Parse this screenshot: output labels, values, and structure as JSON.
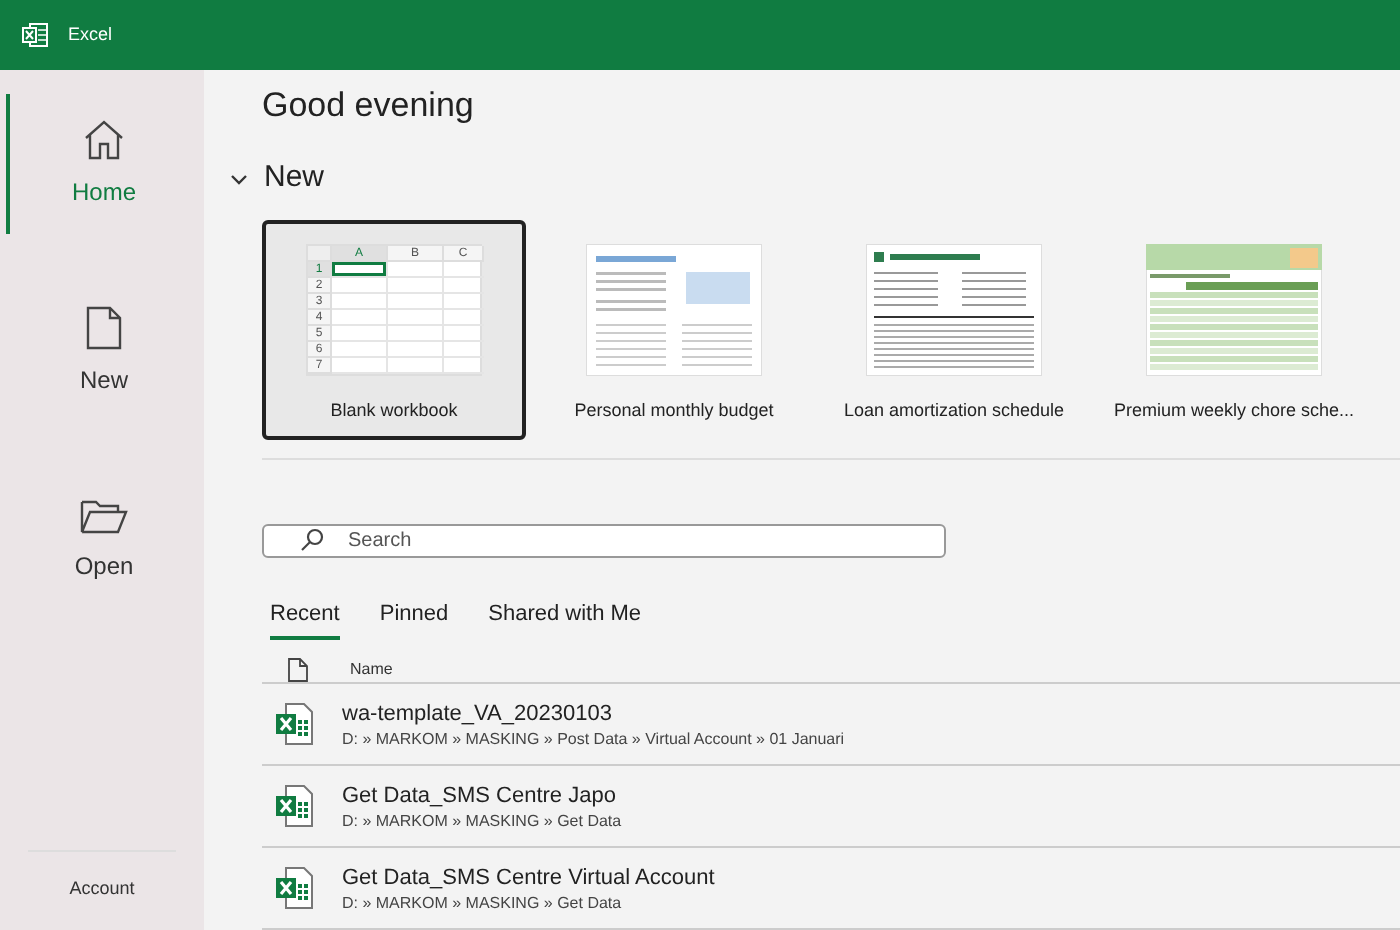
{
  "window": {
    "title": "Excel"
  },
  "sidebar": {
    "items": [
      {
        "kind": "home",
        "label": "Home",
        "selected": true
      },
      {
        "kind": "new",
        "label": "New",
        "selected": false
      },
      {
        "kind": "open",
        "label": "Open",
        "selected": false
      }
    ],
    "footer": "Account"
  },
  "greeting": "Good evening",
  "new_section": {
    "title": "New",
    "expanded": true,
    "templates": [
      {
        "kind": "blank",
        "label": "Blank workbook",
        "selected": true,
        "columns": [
          "A",
          "B",
          "C"
        ],
        "rows": [
          "1",
          "2",
          "3",
          "4",
          "5",
          "6",
          "7"
        ]
      },
      {
        "kind": "budget",
        "label": "Personal monthly budget",
        "selected": false
      },
      {
        "kind": "loan",
        "label": "Loan amortization schedule",
        "selected": false
      },
      {
        "kind": "chore",
        "label": "Premium weekly chore sche...",
        "selected": false
      }
    ]
  },
  "search": {
    "placeholder": "Search"
  },
  "tabs": [
    {
      "label": "Recent",
      "selected": true
    },
    {
      "label": "Pinned",
      "selected": false
    },
    {
      "label": "Shared with Me",
      "selected": false
    }
  ],
  "files": {
    "column": "Name",
    "rows": [
      {
        "name": "wa-template_VA_20230103",
        "path": "D: » MARKOM » MASKING » Post Data » Virtual Account » 01 Januari"
      },
      {
        "name": "Get Data_SMS Centre Japo",
        "path": "D: » MARKOM » MASKING » Get Data"
      },
      {
        "name": "Get Data_SMS Centre Virtual Account",
        "path": "D: » MARKOM » MASKING » Get Data"
      }
    ]
  }
}
